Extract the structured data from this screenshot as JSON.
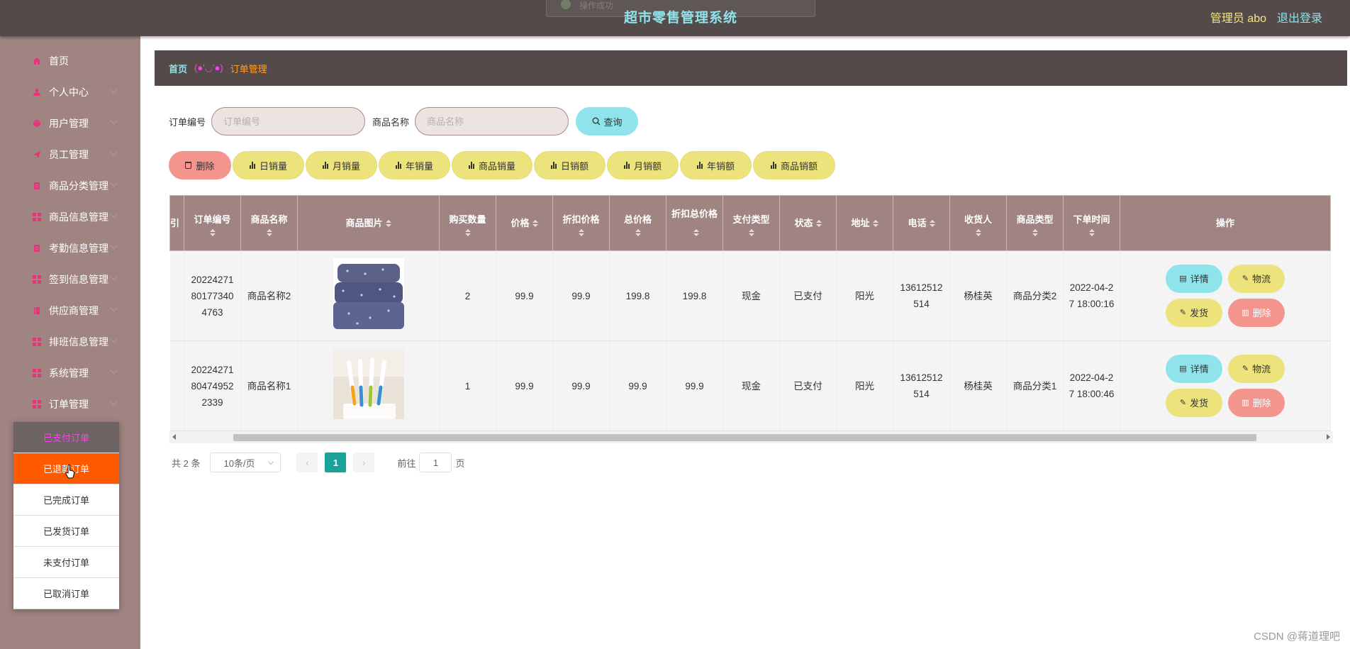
{
  "header": {
    "title": "超市零售管理系统",
    "user": "管理员 abo",
    "logout": "退出登录",
    "toast": "操作成功"
  },
  "sidebar": {
    "items": [
      {
        "label": "首页",
        "icon": "home-icon"
      },
      {
        "label": "个人中心",
        "icon": "user-icon"
      },
      {
        "label": "用户管理",
        "icon": "palette-icon"
      },
      {
        "label": "员工管理",
        "icon": "send-icon"
      },
      {
        "label": "商品分类管理",
        "icon": "clipboard-icon"
      },
      {
        "label": "商品信息管理",
        "icon": "grid-icon"
      },
      {
        "label": "考勤信息管理",
        "icon": "clipboard-icon"
      },
      {
        "label": "签到信息管理",
        "icon": "grid-icon"
      },
      {
        "label": "供应商管理",
        "icon": "book-icon"
      },
      {
        "label": "排班信息管理",
        "icon": "grid-icon"
      },
      {
        "label": "系统管理",
        "icon": "grid-icon"
      },
      {
        "label": "订单管理",
        "icon": "grid-icon"
      }
    ],
    "submenu": [
      "已支付订单",
      "已退款订单",
      "已完成订单",
      "已发货订单",
      "未支付订单",
      "已取消订单"
    ]
  },
  "breadcrumb": {
    "home": "首页",
    "separator": "(●'◡'●)",
    "current": "订单管理"
  },
  "search": {
    "order_label": "订单编号",
    "order_placeholder": "订单编号",
    "product_label": "商品名称",
    "product_placeholder": "商品名称",
    "query": "查询"
  },
  "actions": {
    "delete": "删除",
    "stats": [
      "日销量",
      "月销量",
      "年销量",
      "商品销量",
      "日销额",
      "月销额",
      "年销额",
      "商品销额"
    ]
  },
  "table": {
    "headers": [
      "订单编号",
      "商品名称",
      "商品图片",
      "购买数量",
      "价格",
      "折扣价格",
      "总价格",
      "折扣总价格",
      "支付类型",
      "状态",
      "地址",
      "电话",
      "收货人",
      "商品类型",
      "下单时间",
      "操作"
    ],
    "rows": [
      {
        "order_no": "20224271801773404763",
        "name": "商品名称2",
        "image": "pillow-image",
        "qty": "2",
        "price": "99.9",
        "discount_price": "99.9",
        "total": "199.8",
        "discount_total": "199.8",
        "pay_type": "现金",
        "status": "已支付",
        "address": "阳光",
        "phone": "13612512514",
        "receiver": "杨桂英",
        "category": "商品分类2",
        "time": "2022-04-27 18:00:16"
      },
      {
        "order_no": "20224271804749522339",
        "name": "商品名称1",
        "image": "toothbrush-image",
        "qty": "1",
        "price": "99.9",
        "discount_price": "99.9",
        "total": "99.9",
        "discount_total": "99.9",
        "pay_type": "现金",
        "status": "已支付",
        "address": "阳光",
        "phone": "13612512514",
        "receiver": "杨桂英",
        "category": "商品分类1",
        "time": "2022-04-27 18:00:46"
      }
    ],
    "ops": {
      "detail": "详情",
      "logistics": "物流",
      "ship": "发货",
      "delete": "删除"
    }
  },
  "pagination": {
    "total": "共 2 条",
    "page_size": "10条/页",
    "current": "1",
    "goto_label": "前往",
    "goto_value": "1",
    "page_suffix": "页"
  },
  "watermark": "CSDN @蒋道理吧",
  "colors": {
    "topbar": "#534a49",
    "sidebar": "#9f8481",
    "accent_cyan": "#8fe3ea",
    "accent_yellow": "#ede37c",
    "accent_red": "#f3948d",
    "active_orange": "#ff5a00"
  }
}
